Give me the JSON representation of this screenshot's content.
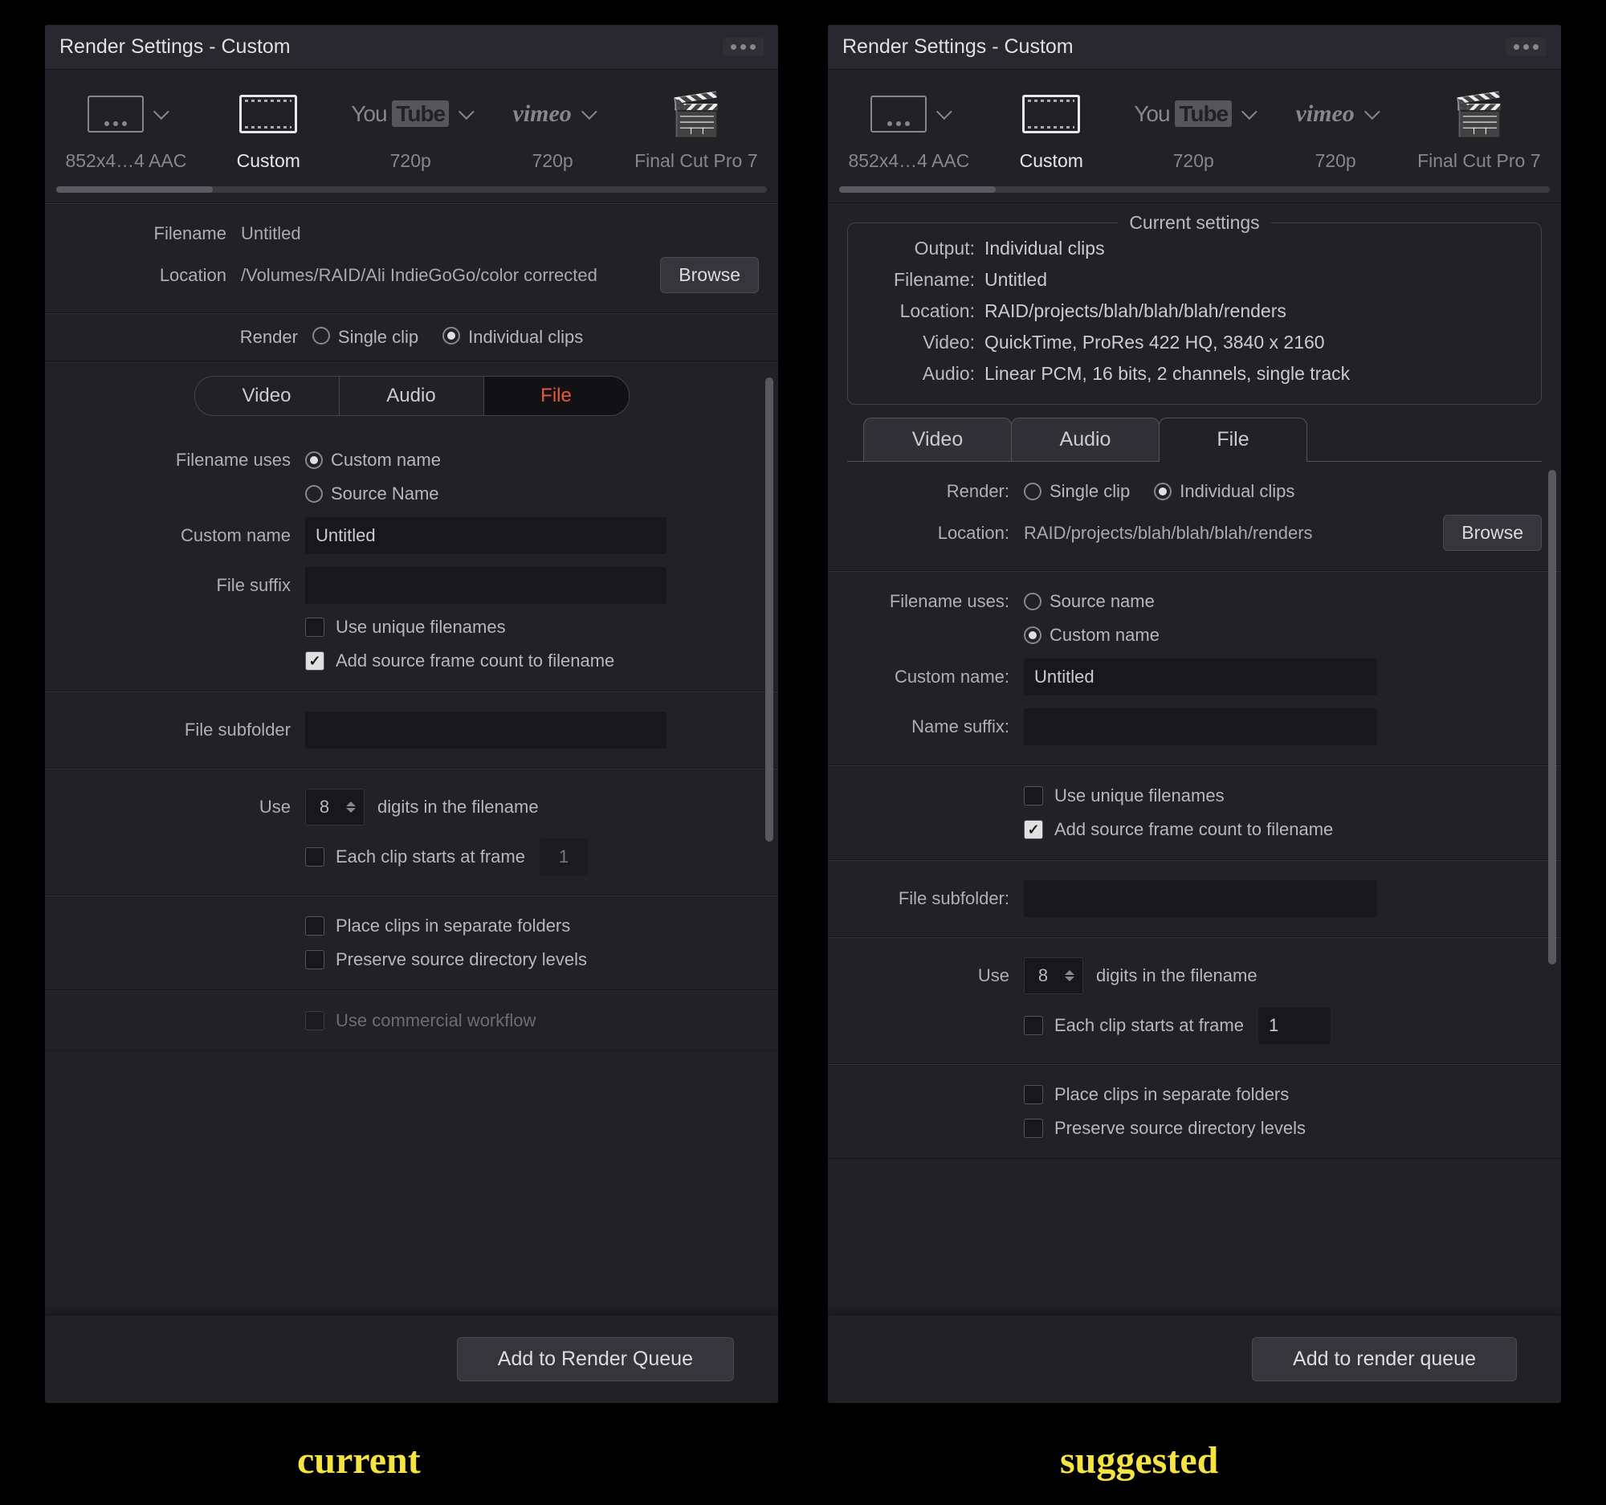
{
  "labels": {
    "current": "current",
    "suggested": "suggested"
  },
  "title": "Render Settings - Custom",
  "presets": {
    "p0": "852x4…4 AAC",
    "p1": "Custom",
    "p2": "720p",
    "p3": "720p",
    "p4": "Final Cut Pro 7"
  },
  "left": {
    "filename_label": "Filename",
    "filename_value": "Untitled",
    "location_label": "Location",
    "location_value": "/Volumes/RAID/Ali IndieGoGo/color corrected",
    "browse": "Browse",
    "render_label": "Render",
    "single_clip": "Single clip",
    "individual_clips": "Individual clips",
    "tabs": {
      "video": "Video",
      "audio": "Audio",
      "file": "File"
    },
    "filename_uses_label": "Filename uses",
    "custom_name_opt": "Custom name",
    "source_name_opt": "Source Name",
    "custom_name_label": "Custom name",
    "custom_name_value": "Untitled",
    "file_suffix_label": "File suffix",
    "use_unique": "Use unique filenames",
    "add_frame_count": "Add source frame count to filename",
    "file_subfolder_label": "File subfolder",
    "use_label": "Use",
    "digits_value": "8",
    "digits_after": "digits in the filename",
    "each_clip": "Each clip starts at frame",
    "each_clip_value": "1",
    "place_clips": "Place clips in separate folders",
    "preserve": "Preserve source directory levels",
    "commercial": "Use commercial workflow",
    "add_queue": "Add to Render Queue"
  },
  "right": {
    "cs_title": "Current settings",
    "cs": {
      "output_l": "Output:",
      "output_v": "Individual clips",
      "filename_l": "Filename:",
      "filename_v": "Untitled",
      "location_l": "Location:",
      "location_v": "RAID/projects/blah/blah/blah/renders",
      "video_l": "Video:",
      "video_v": "QuickTime, ProRes 422 HQ, 3840 x 2160",
      "audio_l": "Audio:",
      "audio_v": "Linear PCM, 16 bits, 2 channels, single track"
    },
    "tabs": {
      "video": "Video",
      "audio": "Audio",
      "file": "File"
    },
    "render_label": "Render:",
    "single_clip": "Single clip",
    "individual_clips": "Individual clips",
    "location_label": "Location:",
    "location_value": "RAID/projects/blah/blah/blah/renders",
    "browse": "Browse",
    "filename_uses_label": "Filename uses:",
    "source_name_opt": "Source name",
    "custom_name_opt": "Custom name",
    "custom_name_label": "Custom name:",
    "custom_name_value": "Untitled",
    "name_suffix_label": "Name suffix:",
    "use_unique": "Use unique filenames",
    "add_frame_count": "Add source frame count to filename",
    "file_subfolder_label": "File subfolder:",
    "use_label": "Use",
    "digits_value": "8",
    "digits_after": "digits in the filename",
    "each_clip": "Each clip starts at frame",
    "each_clip_value": "1",
    "place_clips": "Place clips in separate folders",
    "preserve": "Preserve source directory levels",
    "add_queue": "Add to render queue"
  }
}
